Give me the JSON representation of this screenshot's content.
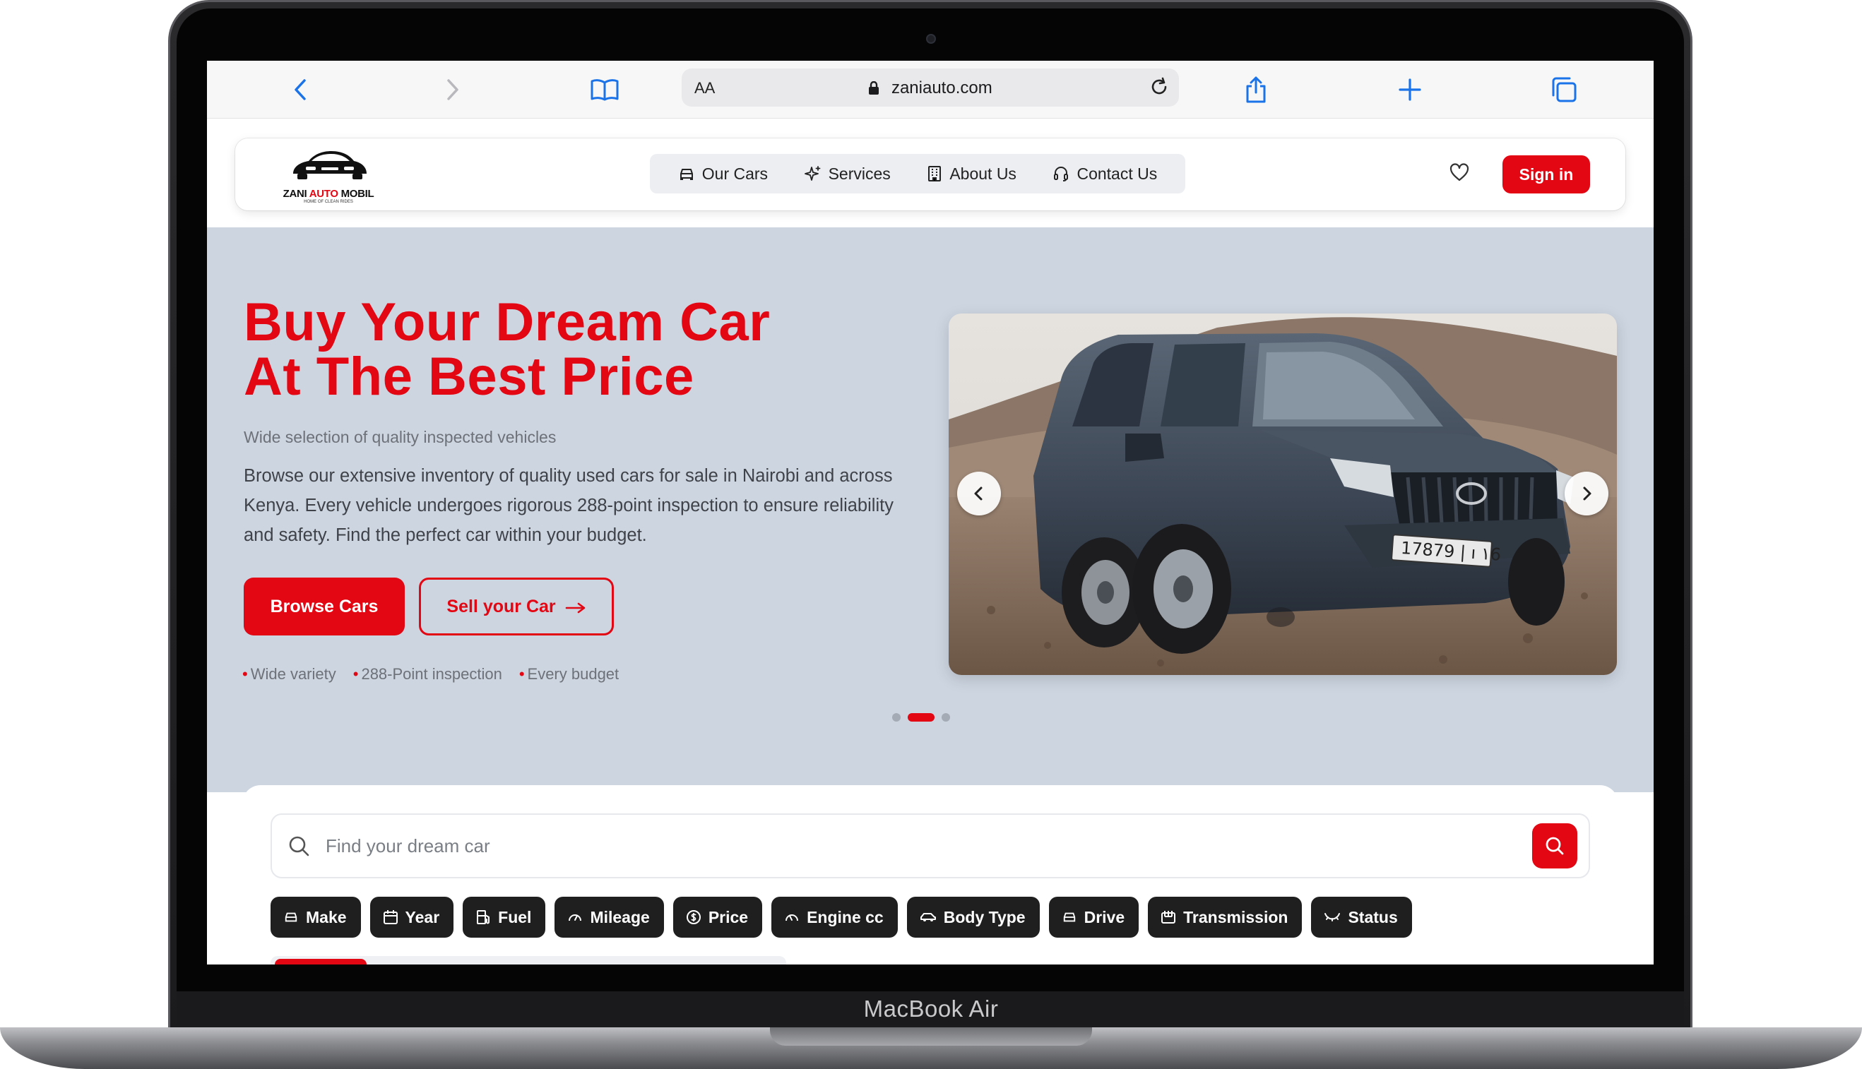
{
  "device": {
    "label": "MacBook Air"
  },
  "browser": {
    "text_size_label": "AA",
    "url": "zaniauto.com"
  },
  "site": {
    "logo": {
      "name": "ZANI AUTO MOBIL",
      "name_part1": "ZANI ",
      "name_part2": "AUTO",
      "name_part3": " MOBIL",
      "tagline": "HOME OF CLEAN RIDES"
    },
    "nav": [
      {
        "label": "Our Cars",
        "icon": "car-icon"
      },
      {
        "label": "Services",
        "icon": "sparkle-icon"
      },
      {
        "label": "About Us",
        "icon": "building-icon"
      },
      {
        "label": "Contact Us",
        "icon": "headset-icon"
      }
    ],
    "signin_label": "Sign in",
    "accent": "#e30613"
  },
  "hero": {
    "title_line1": "Buy Your Dream Car",
    "title_line2": "At The Best Price",
    "subtitle": "Wide selection of quality inspected vehicles",
    "description": "Browse our extensive inventory of quality used cars for sale in Nairobi and across Kenya. Every vehicle undergoes rigorous 288-point inspection to ensure reliability and safety. Find the perfect car within your budget.",
    "browse_label": "Browse Cars",
    "sell_label": "Sell your Car",
    "features": [
      "Wide variety",
      "288-Point inspection",
      "Every budget"
    ],
    "carousel": {
      "slide_count": 3,
      "active_slide": 2,
      "plate": "17879 | ı ١6"
    }
  },
  "search": {
    "placeholder": "Find your dream car",
    "value": "",
    "filters": [
      {
        "label": "Make",
        "icon": "car-icon"
      },
      {
        "label": "Year",
        "icon": "calendar-icon"
      },
      {
        "label": "Fuel",
        "icon": "fuel-icon"
      },
      {
        "label": "Mileage",
        "icon": "gauge-icon"
      },
      {
        "label": "Price",
        "icon": "dollar-icon"
      },
      {
        "label": "Engine cc",
        "icon": "gauge-icon"
      },
      {
        "label": "Body Type",
        "icon": "car-body-icon"
      },
      {
        "label": "Drive",
        "icon": "car-icon"
      },
      {
        "label": "Transmission",
        "icon": "gearbox-icon"
      },
      {
        "label": "Status",
        "icon": "status-icon"
      }
    ]
  }
}
